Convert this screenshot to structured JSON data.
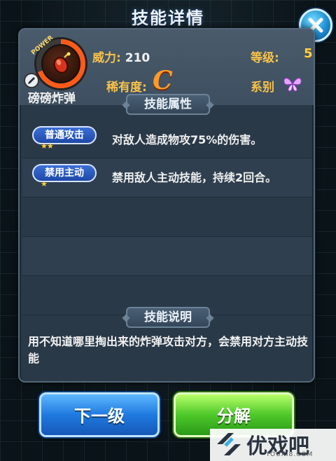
{
  "dialog": {
    "title": "技能详情"
  },
  "skill": {
    "icon_name": "bomb-icon",
    "power_label": "POWER",
    "name": "磅磅炸弹",
    "power_key": "威力:",
    "power_value": "210",
    "rarity_key": "稀有度:",
    "rarity_value": "C",
    "level_key": "等级:",
    "level_value": "5",
    "series_key": "系别"
  },
  "sections": {
    "attributes_title": "技能属性",
    "description_title": "技能说明"
  },
  "attributes": [
    {
      "name": "普通攻击",
      "stars": 2,
      "desc": "对敌人造成物攻75%的伤害。"
    },
    {
      "name": "禁用主动",
      "stars": 1,
      "desc": "禁用敌人主动技能，持续2回合。"
    }
  ],
  "description": "用不知道哪里掏出来的炸弹攻击对方，会禁用对方主动技能",
  "buttons": {
    "next_level": "下一级",
    "decompose": "分解"
  },
  "watermark": {
    "text": "优戏吧",
    "url": "YOUXI8.COM"
  },
  "colors": {
    "accent_gold": "#f8c24a",
    "rarity_orange": "#ff9a2a",
    "button_blue": "#1f7ae0",
    "button_green": "#4ec82a"
  }
}
